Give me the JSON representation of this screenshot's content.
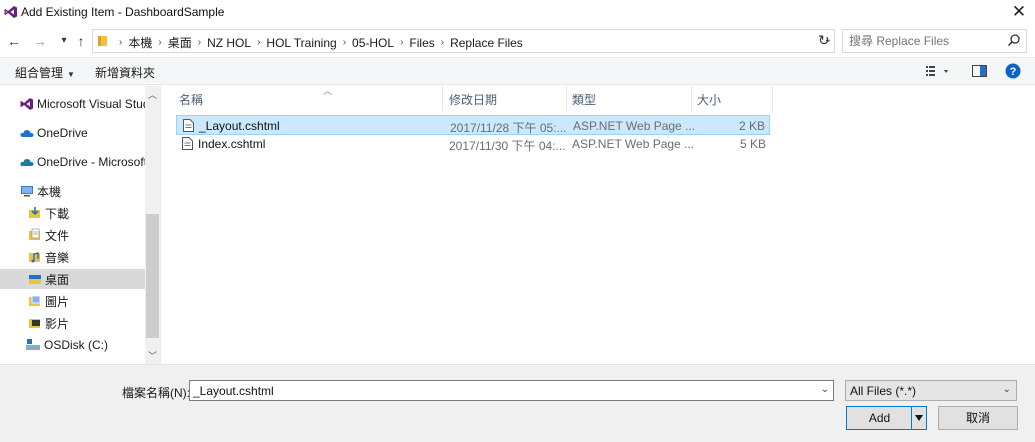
{
  "window": {
    "title": "Add Existing Item - DashboardSample",
    "close_glyph": "✕"
  },
  "nav": {
    "back": "←",
    "forward": "→",
    "recent": "▾",
    "up": "↑"
  },
  "address": {
    "crumbs": [
      "本機",
      "桌面",
      "NZ HOL",
      "HOL Training",
      "05-HOL",
      "Files",
      "Replace Files"
    ],
    "dropdown_glyph": "⌄",
    "refresh_glyph": "↻"
  },
  "search": {
    "placeholder": "搜尋 Replace Files"
  },
  "toolbar": {
    "organize": "組合管理",
    "new_folder": "新增資料夾"
  },
  "sidebar": {
    "items": [
      {
        "label": "Microsoft Visual Studio",
        "icon": "visual-studio-icon"
      },
      {
        "label": "OneDrive",
        "icon": "cloud-icon"
      },
      {
        "label": "OneDrive - Microsoft",
        "icon": "cloud-icon"
      },
      {
        "label": "本機",
        "icon": "computer-icon"
      },
      {
        "label": "下載",
        "icon": "downloads-icon"
      },
      {
        "label": "文件",
        "icon": "documents-icon"
      },
      {
        "label": "音樂",
        "icon": "music-icon"
      },
      {
        "label": "桌面",
        "icon": "desktop-icon",
        "selected": true
      },
      {
        "label": "圖片",
        "icon": "pictures-icon"
      },
      {
        "label": "影片",
        "icon": "videos-icon"
      },
      {
        "label": "OSDisk (C:)",
        "icon": "drive-icon"
      }
    ]
  },
  "columns": {
    "name": "名稱",
    "date": "修改日期",
    "type": "類型",
    "size": "大小"
  },
  "files": [
    {
      "name": "_Layout.cshtml",
      "date": "2017/11/28 下午 05:...",
      "type": "ASP.NET Web Page ...",
      "size": "2 KB",
      "selected": true
    },
    {
      "name": "Index.cshtml",
      "date": "2017/11/30 下午 04:...",
      "type": "ASP.NET Web Page ...",
      "size": "5 KB",
      "selected": false
    }
  ],
  "footer": {
    "filename_label": "檔案名稱(N):",
    "filename_value": "_Layout.cshtml",
    "filter_value": "All Files (*.*)",
    "add_label": "Add",
    "cancel_label": "取消"
  },
  "colors": {
    "selection": "#cce8ff",
    "accent": "#0078d7",
    "help": "#0a64c8"
  }
}
